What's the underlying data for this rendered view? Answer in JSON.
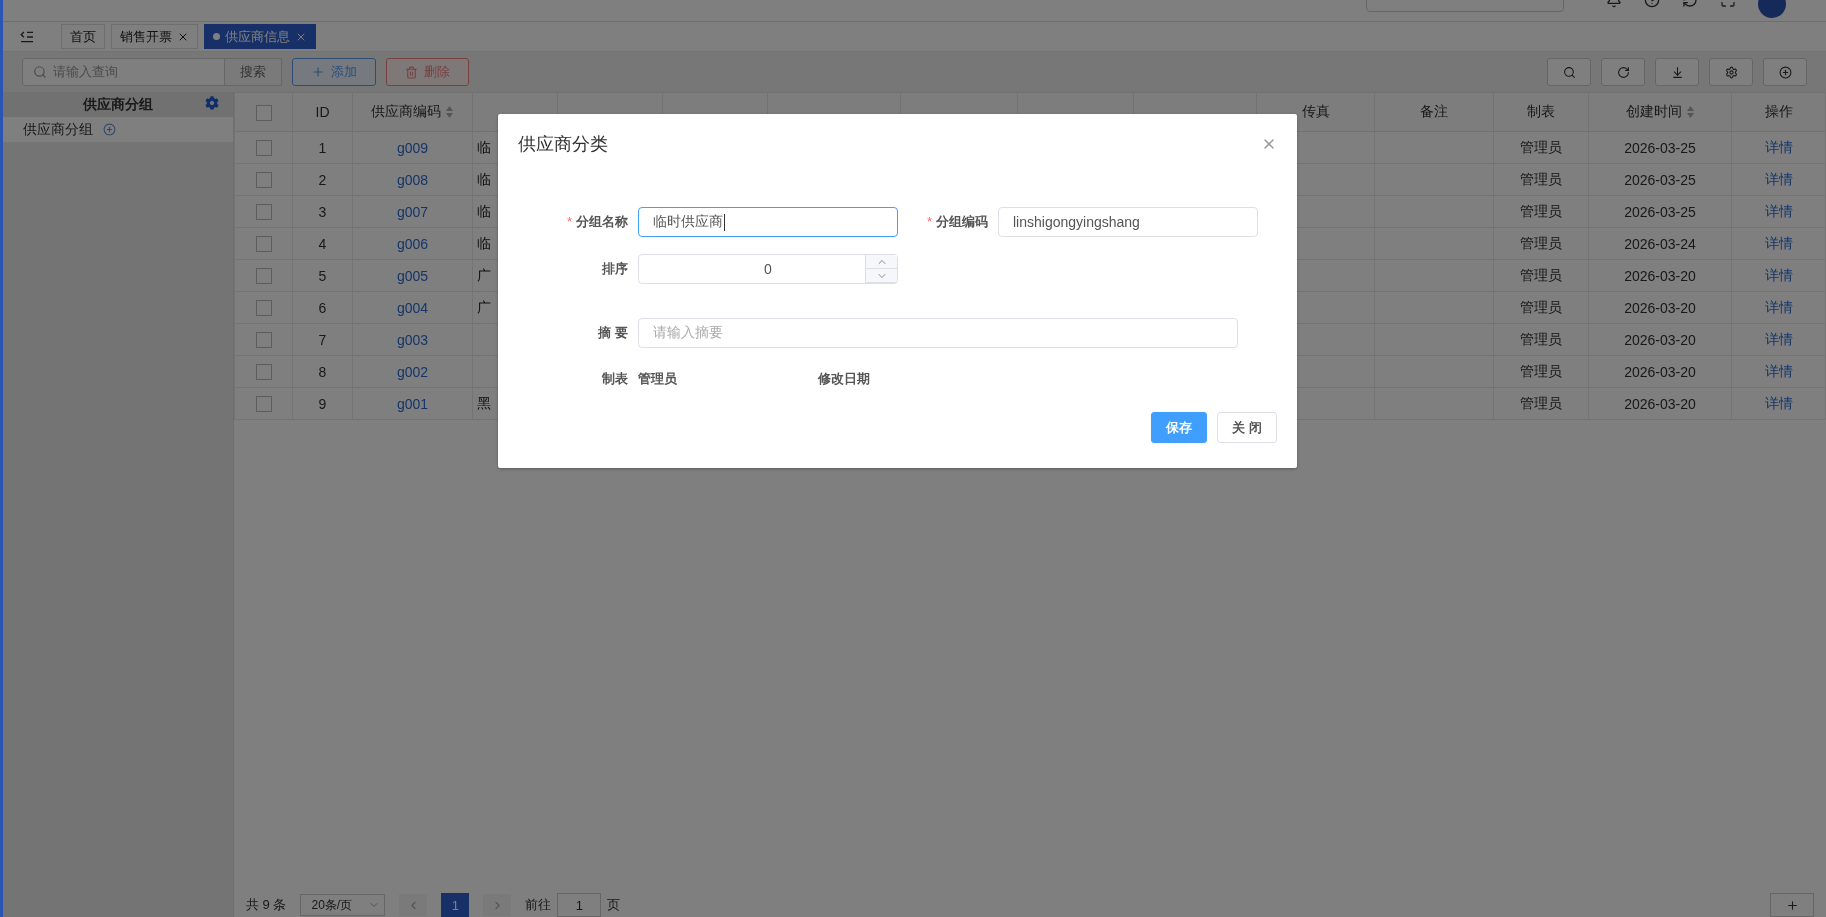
{
  "tabs": [
    {
      "label": "首页",
      "closable": false,
      "selected": false
    },
    {
      "label": "销售开票",
      "closable": true,
      "selected": false
    },
    {
      "label": "供应商信息",
      "closable": true,
      "selected": true
    }
  ],
  "toolbar": {
    "search_placeholder": "请输入查询",
    "search_button": "搜索",
    "add_button": "添加",
    "delete_button": "删除"
  },
  "sidebar": {
    "title": "供应商分组",
    "items": [
      {
        "label": "供应商分组"
      }
    ]
  },
  "table": {
    "all_checked": false,
    "columns": [
      {
        "label": "ID",
        "sortable": false
      },
      {
        "label": "供应商编码",
        "sortable": true
      },
      {},
      {},
      {},
      {},
      {},
      {},
      {},
      {
        "label": "传真",
        "sortable": false
      },
      {
        "label": "备注",
        "sortable": false
      },
      {
        "label": "制表",
        "sortable": false
      },
      {
        "label": "创建时间",
        "sortable": true
      },
      {
        "label": "操作",
        "sortable": false
      }
    ],
    "rows": [
      {
        "checked": false,
        "id": "1",
        "code": "g009",
        "supplier": "临",
        "maker": "管理员",
        "created": "2026-03-25",
        "action": "详情"
      },
      {
        "checked": false,
        "id": "2",
        "code": "g008",
        "supplier": "临",
        "maker": "管理员",
        "created": "2026-03-25",
        "action": "详情"
      },
      {
        "checked": false,
        "id": "3",
        "code": "g007",
        "supplier": "临",
        "maker": "管理员",
        "created": "2026-03-25",
        "action": "详情"
      },
      {
        "checked": false,
        "id": "4",
        "code": "g006",
        "supplier": "临",
        "maker": "管理员",
        "created": "2026-03-24",
        "action": "详情"
      },
      {
        "checked": false,
        "id": "5",
        "code": "g005",
        "supplier": "广",
        "maker": "管理员",
        "created": "2026-03-20",
        "action": "详情"
      },
      {
        "checked": false,
        "id": "6",
        "code": "g004",
        "supplier": "广",
        "maker": "管理员",
        "created": "2026-03-20",
        "action": "详情"
      },
      {
        "checked": false,
        "id": "7",
        "code": "g003",
        "maker": "管理员",
        "created": "2026-03-20",
        "action": "详情"
      },
      {
        "checked": false,
        "id": "8",
        "code": "g002",
        "maker": "管理员",
        "created": "2026-03-20",
        "action": "详情"
      },
      {
        "checked": false,
        "id": "9",
        "code": "g001",
        "supplier": "黑",
        "maker": "管理员",
        "created": "2026-03-20",
        "action": "详情"
      }
    ]
  },
  "pagination": {
    "total": "共 9 条",
    "page_size": "20条/页",
    "pages": [
      {
        "label": "1",
        "selected": true
      }
    ],
    "goto_label": "前往",
    "goto_value": "1",
    "page_unit": "页"
  },
  "dialog": {
    "title": "供应商分类",
    "required_mark": "*",
    "fields": [
      {
        "label": "分组名称",
        "required": true,
        "kind": "text",
        "value": "临时供应商",
        "focused": true
      },
      {
        "label": "分组编码",
        "required": true,
        "kind": "text",
        "value": "linshigongyingshang",
        "focused": false
      },
      {
        "label": "排序",
        "required": false,
        "kind": "number",
        "value": "0",
        "focused": false
      },
      {
        "label": "摘 要",
        "required": false,
        "kind": "text",
        "placeholder": "请输入摘要",
        "focused": false
      }
    ],
    "info": [
      {
        "label": "制表",
        "value": "管理员"
      },
      {
        "label": "修改日期"
      }
    ],
    "buttons": [
      {
        "label": "保存",
        "primary": true
      },
      {
        "label": "关 闭",
        "primary": false
      }
    ]
  }
}
